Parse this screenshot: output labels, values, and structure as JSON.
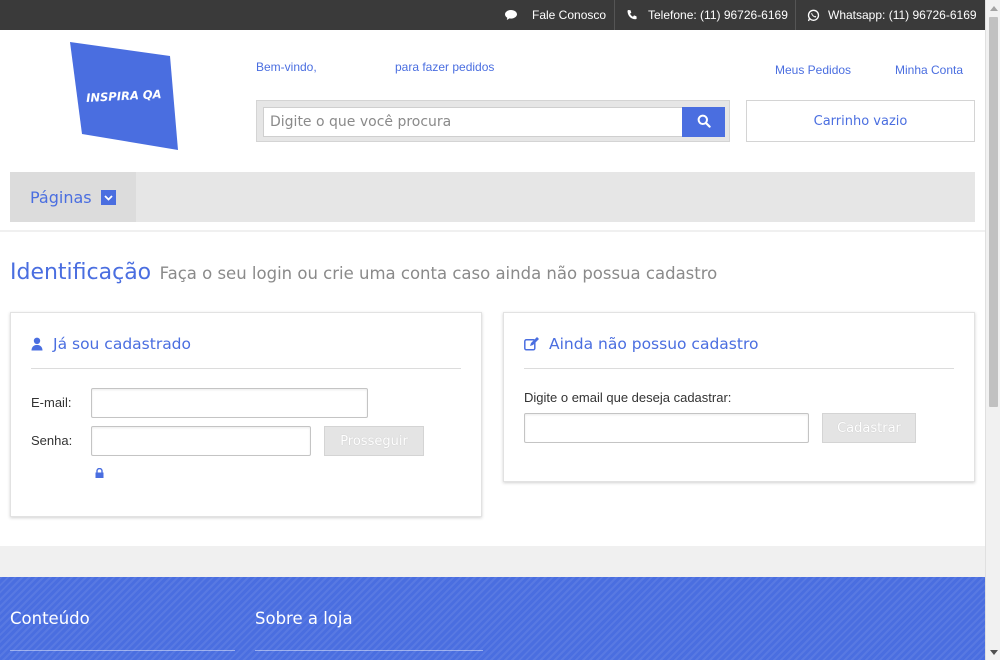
{
  "topbar": {
    "contact_label": "Fale Conosco",
    "phone_label": "Telefone: (11) 96726-6169",
    "whatsapp_label": "Whatsapp: (11) 96726-6169",
    "icons": [
      "chat-icon",
      "phone-icon",
      "whatsapp-icon"
    ]
  },
  "header": {
    "logo_text": "INSPIRA QA",
    "welcome_text": "Bem-vindo,",
    "login_text": "para fazer pedidos",
    "links": [
      "Meus Pedidos",
      "Minha Conta"
    ],
    "search": {
      "placeholder": "Digite o que você procura",
      "button_icon": "search-icon"
    },
    "cart_label": "Carrinho vazio"
  },
  "nav": {
    "pages_label": "Páginas",
    "caret_icon": "chevron-down-icon"
  },
  "main": {
    "title": "Identificação",
    "subtitle": "Faça o seu login ou crie uma conta caso ainda não possua cadastro",
    "login_card": {
      "heading": "Já sou cadastrado",
      "icon": "user-icon",
      "email_label": "E-mail:",
      "password_label": "Senha:",
      "submit_label": "Prosseguir",
      "lock_icon": "lock-icon"
    },
    "register_card": {
      "heading": "Ainda não possuo cadastro",
      "icon": "edit-icon",
      "prompt": "Digite o email que deseja cadastrar:",
      "submit_label": "Cadastrar"
    }
  },
  "footer": {
    "col1_heading": "Conteúdo",
    "col2_heading": "Sobre a loja"
  },
  "colors": {
    "accent": "#4a6ee0",
    "topbar": "#3a3a3a",
    "nav_bg": "#e6e6e6"
  }
}
